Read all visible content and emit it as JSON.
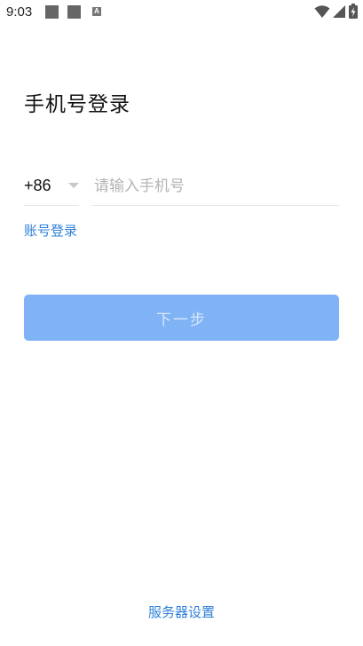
{
  "status_bar": {
    "time": "9:03",
    "notification_letter": "A",
    "icons": [
      "notification-square-icon",
      "notification-square-icon",
      "a-notification-icon",
      "wifi-icon",
      "cellular-icon",
      "battery-charging-icon"
    ]
  },
  "login": {
    "title": "手机号登录",
    "country_code": "+86",
    "phone_placeholder": "请输入手机号",
    "phone_value": "",
    "account_login_link": "账号登录",
    "next_button": "下一步",
    "server_settings_link": "服务器设置"
  },
  "colors": {
    "accent_link": "#2f80d8",
    "button_disabled_bg": "#7fb3f5",
    "button_disabled_text": "#d8e6fb",
    "placeholder": "#b4b4b4"
  }
}
